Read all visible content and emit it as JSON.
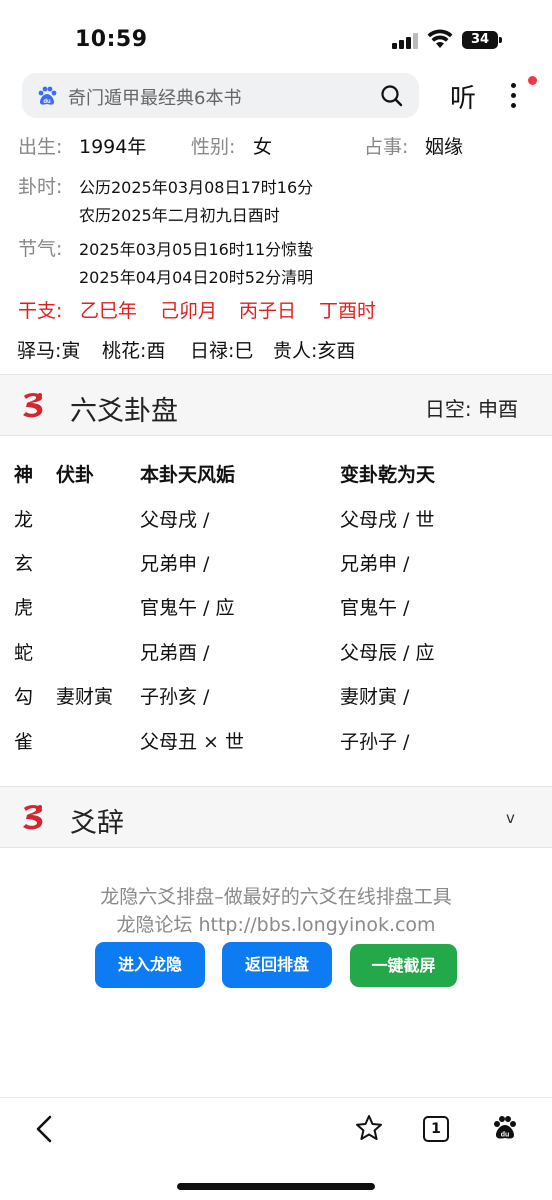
{
  "status_bar": {
    "time": "10:59",
    "battery": "34"
  },
  "search": {
    "query": "奇门遁甲最经典6本书",
    "listen_label": "听"
  },
  "info": {
    "birth_label": "出生:",
    "birth_value": "1994年",
    "gender_label": "性别:",
    "gender_value": "女",
    "matter_label": "占事:",
    "matter_value": "姻缘",
    "time_label": "卦时:",
    "time_solar": "公历2025年03月08日17时16分",
    "time_lunar": "农历2025年二月初九日酉时",
    "term_label": "节气:",
    "term_1": "2025年03月05日16时11分惊蛰",
    "term_2": "2025年04月04日20时52分清明",
    "ganzhi_label": "干支:",
    "ganzhi": [
      "乙巳年",
      "己卯月",
      "丙子日",
      "丁酉时"
    ],
    "shensha": [
      "驿马:寅",
      "桃花:酉",
      "日禄:巳",
      "贵人:亥酉"
    ]
  },
  "gua_section": {
    "title": "六爻卦盘",
    "empty_label": "日空:",
    "empty_value": "申酉",
    "headers": {
      "shen": "神",
      "fu": "伏卦",
      "ben": "本卦天风姤",
      "bian": "变卦乾为天"
    },
    "rows": [
      {
        "shen": "龙",
        "fu": "",
        "ben": "父母戌  /",
        "bian": "父母戌  / 世"
      },
      {
        "shen": "玄",
        "fu": "",
        "ben": "兄弟申  /",
        "bian": "兄弟申  /"
      },
      {
        "shen": "虎",
        "fu": "",
        "ben": "官鬼午  / 应",
        "bian": "官鬼午  /"
      },
      {
        "shen": "蛇",
        "fu": "",
        "ben": "兄弟酉  /",
        "bian": "父母辰  / 应"
      },
      {
        "shen": "勾",
        "fu": "妻财寅",
        "ben": "子孙亥  /",
        "bian": "妻财寅  /"
      },
      {
        "shen": "雀",
        "fu": "",
        "ben": "父母丑 × 世",
        "bian": "子孙子  /"
      }
    ]
  },
  "yaoci_section": {
    "title": "爻辞",
    "chevron": "v"
  },
  "footer": {
    "line1": "龙隐六爻排盘–做最好的六爻在线排盘工具",
    "line2": "龙隐论坛 http://bbs.longyinok.com",
    "btn_enter": "进入龙隐",
    "btn_return": "返回排盘",
    "btn_screenshot": "一键截屏"
  },
  "bottom_nav": {
    "tab_count": "1"
  },
  "colors": {
    "accent_blue": "#0d7cf2",
    "accent_green": "#23a84a",
    "ganzhi_red": "#e02020"
  }
}
